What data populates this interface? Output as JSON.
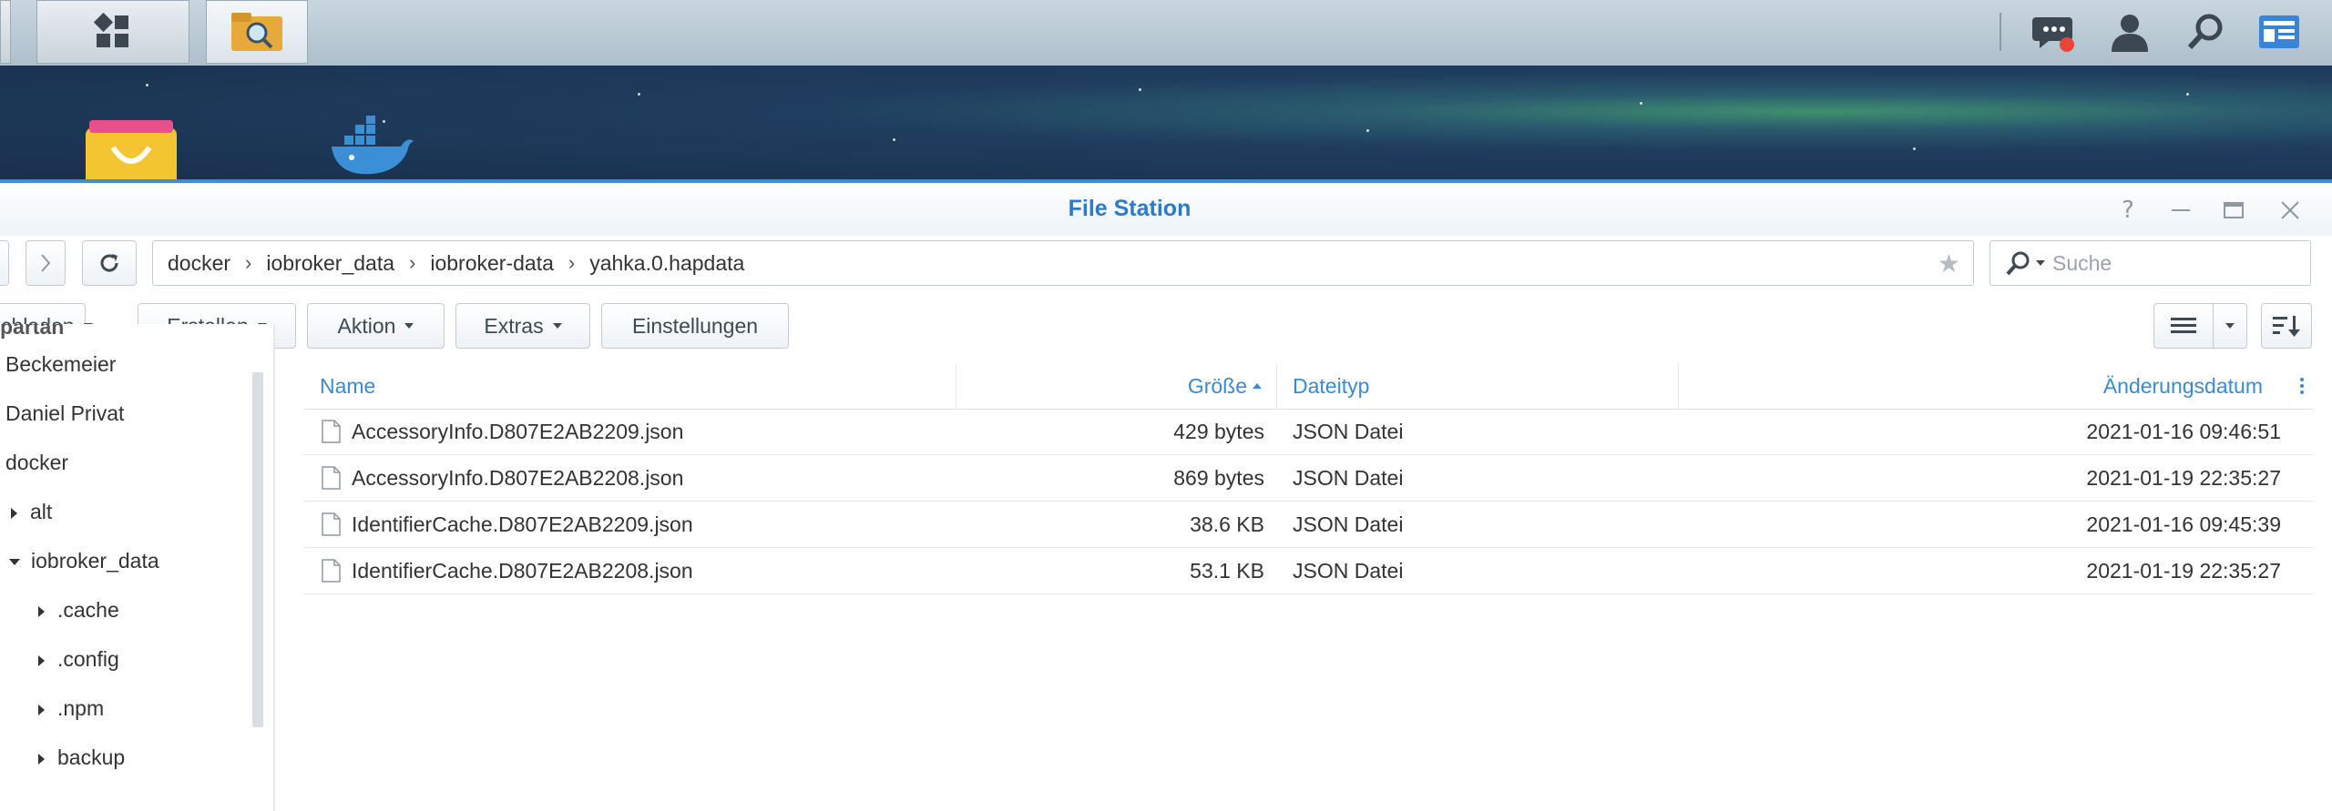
{
  "window": {
    "title": "File Station"
  },
  "path": [
    "docker",
    "iobroker_data",
    "iobroker-data",
    "yahka.0.hapdata"
  ],
  "search": {
    "placeholder": "Suche"
  },
  "toolbar": {
    "upload": "chladen",
    "create": "Erstellen",
    "action": "Aktion",
    "extras": "Extras",
    "settings": "Einstellungen"
  },
  "sidebar": {
    "top_partial": "partan",
    "items": [
      {
        "label": "Beckemeier"
      },
      {
        "label": "Daniel Privat"
      },
      {
        "label": "docker"
      },
      {
        "label": "alt"
      },
      {
        "label": "iobroker_data"
      },
      {
        "label": ".cache"
      },
      {
        "label": ".config"
      },
      {
        "label": ".npm"
      },
      {
        "label": "backup"
      }
    ]
  },
  "grid": {
    "headers": {
      "name": "Name",
      "size": "Größe",
      "type": "Dateityp",
      "modified": "Änderungsdatum"
    },
    "rows": [
      {
        "name": "AccessoryInfo.D807E2AB2209.json",
        "size": "429 bytes",
        "type": "JSON Datei",
        "modified": "2021-01-16 09:46:51"
      },
      {
        "name": "AccessoryInfo.D807E2AB2208.json",
        "size": "869 bytes",
        "type": "JSON Datei",
        "modified": "2021-01-19 22:35:27"
      },
      {
        "name": "IdentifierCache.D807E2AB2209.json",
        "size": "38.6 KB",
        "type": "JSON Datei",
        "modified": "2021-01-16 09:45:39"
      },
      {
        "name": "IdentifierCache.D807E2AB2208.json",
        "size": "53.1 KB",
        "type": "JSON Datei",
        "modified": "2021-01-19 22:35:27"
      }
    ]
  },
  "colors": {
    "accent": "#3c8ad3",
    "title": "#2b7bc8",
    "notification": "#e8443a"
  }
}
